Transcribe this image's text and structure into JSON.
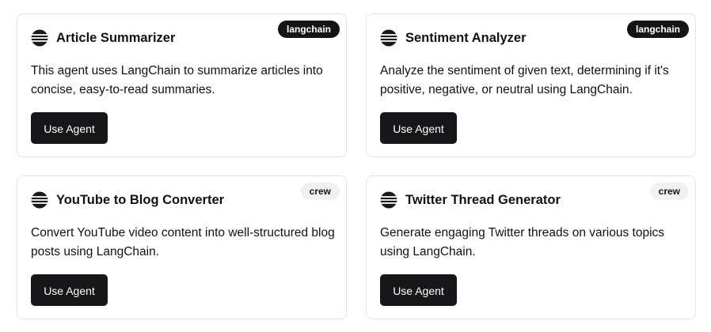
{
  "agents": [
    {
      "badge": "langchain",
      "title": "Article Summarizer",
      "description": "This agent uses LangChain to summarize articles into concise, easy-to-read summaries.",
      "button_label": "Use Agent"
    },
    {
      "badge": "langchain",
      "title": "Sentiment Analyzer",
      "description": "Analyze the sentiment of given text, determining if it's positive, negative, or neutral using LangChain.",
      "button_label": "Use Agent"
    },
    {
      "badge": "crew",
      "title": "YouTube to Blog Converter",
      "description": "Convert YouTube video content into well-structured blog posts using LangChain.",
      "button_label": "Use Agent"
    },
    {
      "badge": "crew",
      "title": "Twitter Thread Generator",
      "description": "Generate engaging Twitter threads on various topics using LangChain.",
      "button_label": "Use Agent"
    }
  ],
  "icon": "agent-logo-icon",
  "colors": {
    "button_bg": "#17171a",
    "badge_dark_bg": "#141414",
    "badge_light_bg": "#f1f1f2",
    "card_border": "#e4e4e7"
  }
}
